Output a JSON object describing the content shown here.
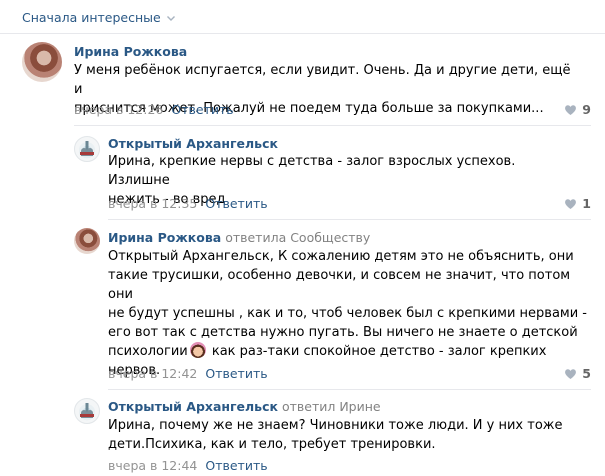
{
  "sort": {
    "label": "Сначала интересные"
  },
  "comments": [
    {
      "author": "Ирина Рожкова",
      "reply_to": "",
      "text": "У меня ребёнок испугается, если увидит. Очень. Да и другие дети, ещё и\nприснится может. Пожалуй не поедем туда больше за покупками...",
      "time": "вчера в 12:26",
      "reply_label": "Ответить",
      "likes": "9"
    },
    {
      "author": "Открытый Архангельск",
      "reply_to": "",
      "text": "Ирина, крепкие нервы с детства - залог взрослых успехов. Излишне\nнежить - во вред",
      "time": "вчера в 12:35",
      "reply_label": "Ответить",
      "likes": "1"
    },
    {
      "author": "Ирина Рожкова",
      "reply_to": "ответила Сообществу",
      "text_before_emoji": "Открытый Архангельск, К сожалению детям это не объяснить, они\nтакие трусишки, особенно девочки, и совсем не значит, что потом они\nне будут успешны , как и то, чтоб человек был с крепкими нервами -\nего вот так с детства нужно пугать. Вы ничего не знаете о детской\nпсихологии",
      "text_after_emoji": " как раз-таки спокойное детство - залог крепких\nнервов.",
      "emoji": "woman-gesturing-emoji",
      "time": "вчера в 12:42",
      "reply_label": "Ответить",
      "likes": "5"
    },
    {
      "author": "Открытый Архангельск",
      "reply_to": "ответил Ирине",
      "text": "Ирина, почему же не знаем? Чиновники тоже люди. И у них тоже\nдети.Психика, как и тело, требует тренировки.",
      "time": "вчера в 12:44",
      "reply_label": "Ответить"
    }
  ],
  "colors": {
    "link": "#2a5885",
    "muted": "#939393",
    "divider": "#e7e8ec"
  }
}
